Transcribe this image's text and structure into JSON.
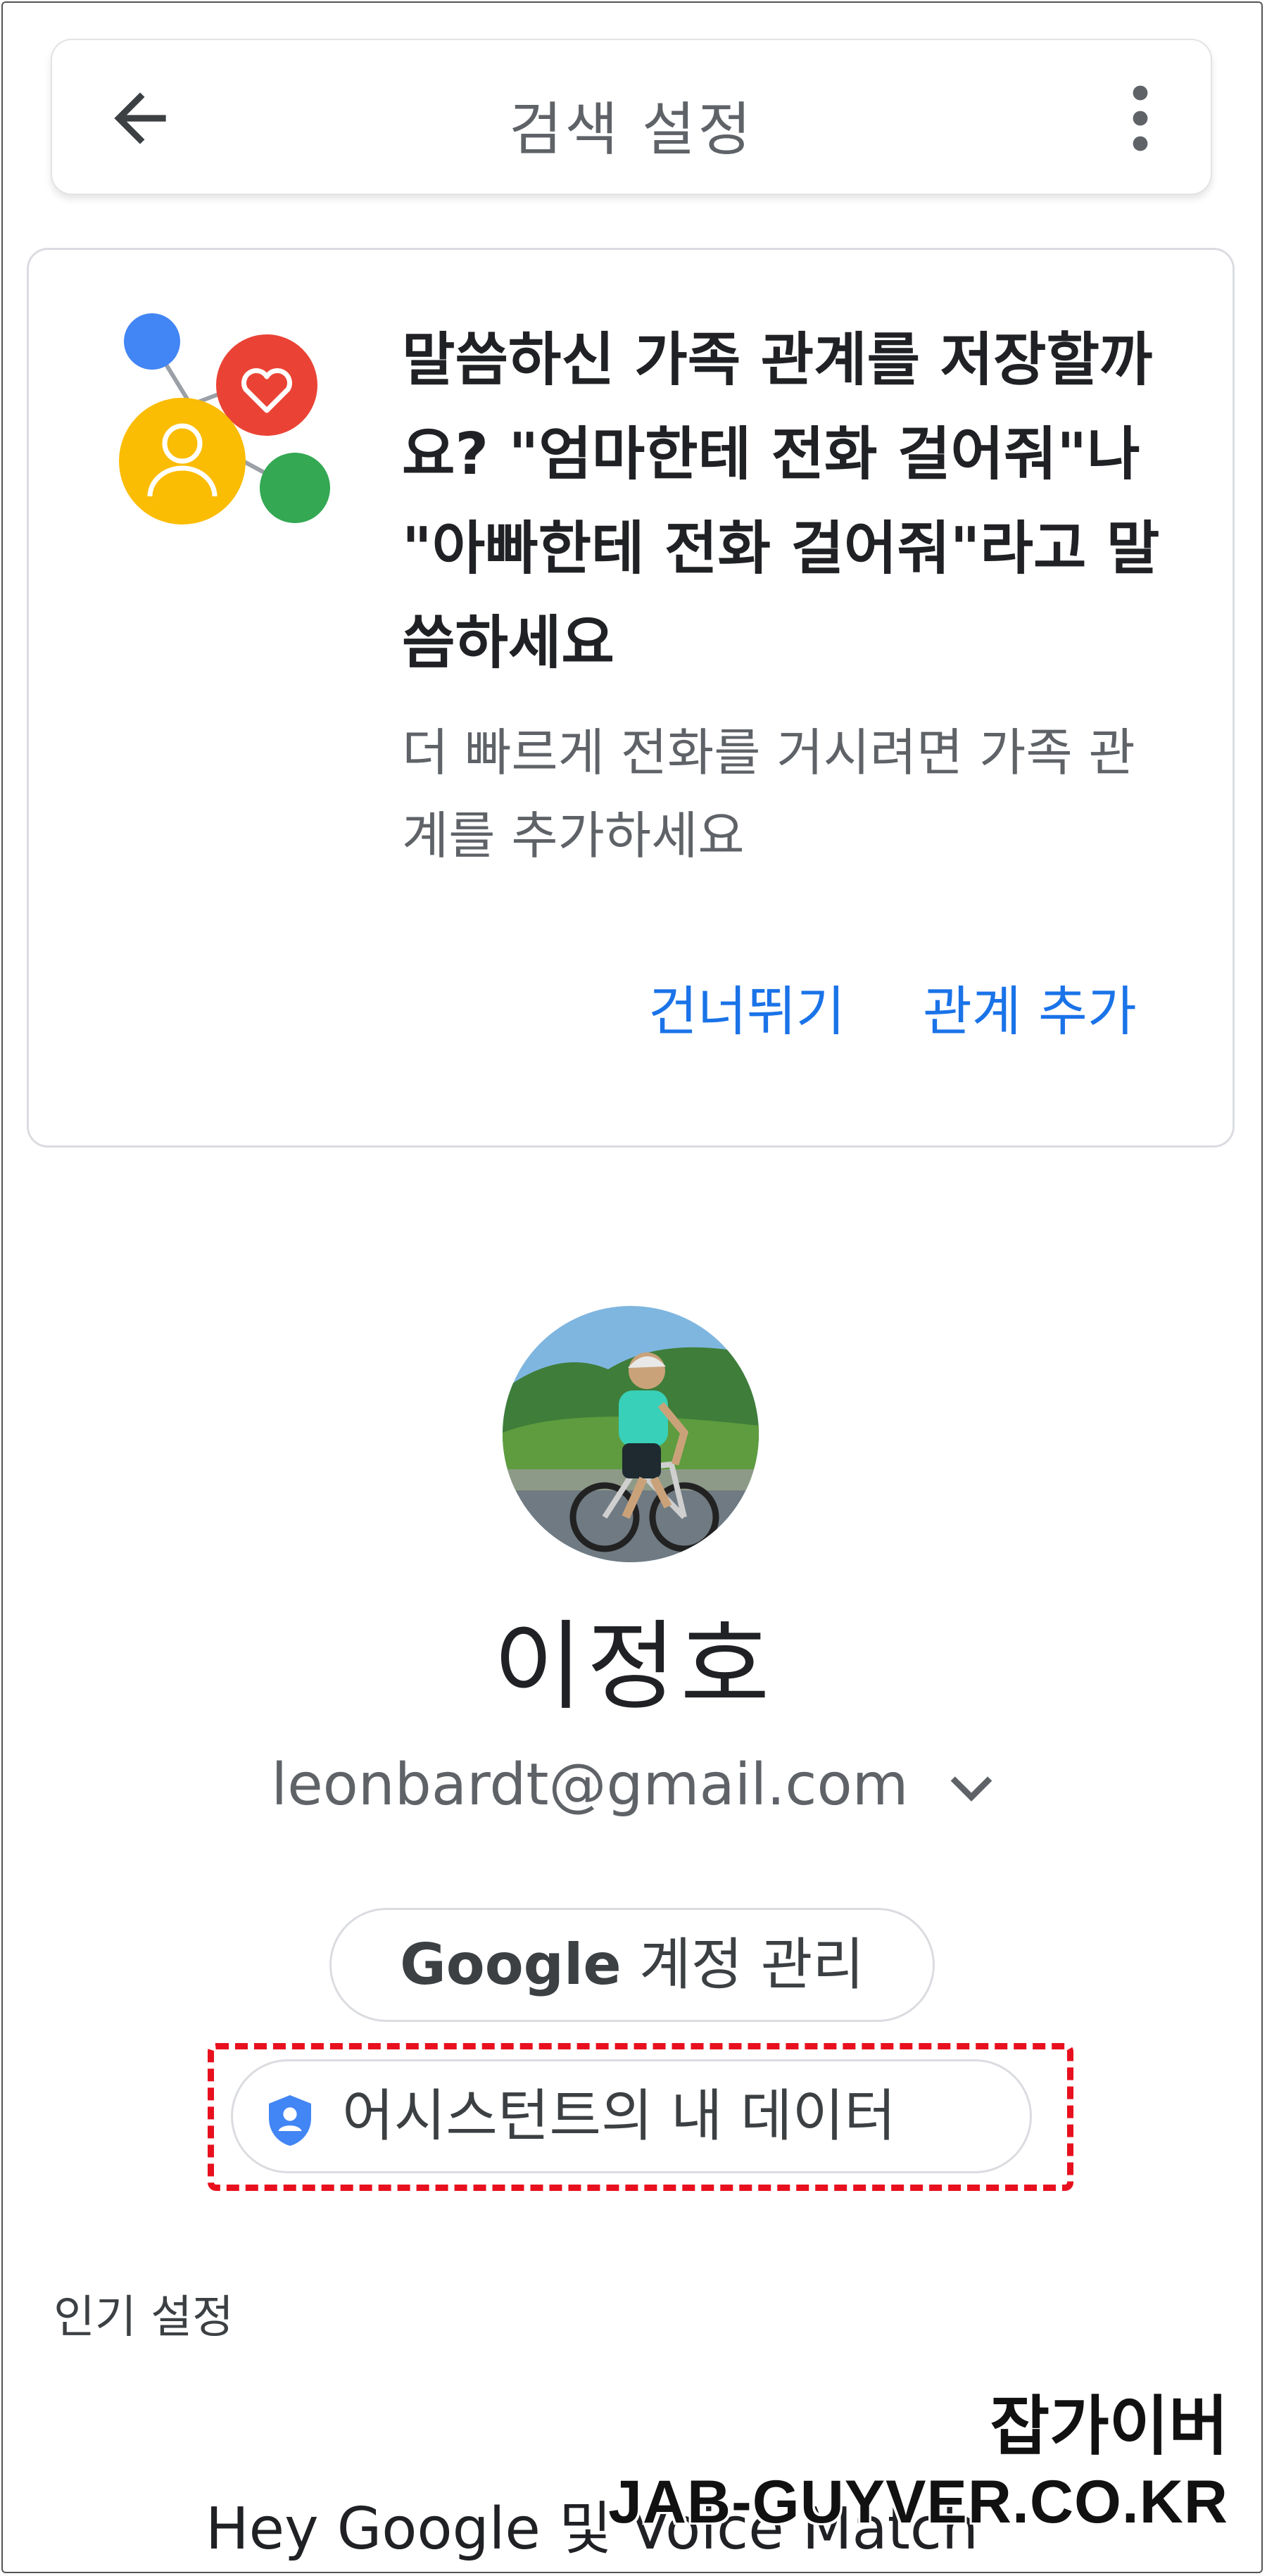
{
  "header": {
    "title": "검색 설정",
    "back_icon": "arrow-back-icon",
    "more_icon": "more-vert-icon"
  },
  "card": {
    "title": "말씀하신 가족 관계를 저장할까요? \"엄마한테 전화 걸어줘\"나 \"아빠한테 전화 걸어줘\"라고 말씀하세요",
    "body": "더 빠르게 전화를 거시려면 가족 관계를 추가하세요",
    "skip_label": "건너뛰기",
    "add_label": "관계 추가",
    "accent_color": "#1a73e8"
  },
  "profile": {
    "name": "이정호",
    "email": "leonbardt@gmail.com",
    "manage_brand": "Google",
    "manage_label": "계정 관리",
    "my_data_label": "어시스턴트의 내 데이터"
  },
  "sections": {
    "popular_label": "인기 설정",
    "first_item": "Hey Google 및 Voice Match"
  },
  "watermark": {
    "korean": "잡가이버",
    "english": "JAB-GUYVER.CO.KR"
  },
  "colors": {
    "highlight": "#e8101e",
    "blue": "#4285f4",
    "red": "#ea4335",
    "yellow": "#fbbc04",
    "green": "#34a853"
  }
}
